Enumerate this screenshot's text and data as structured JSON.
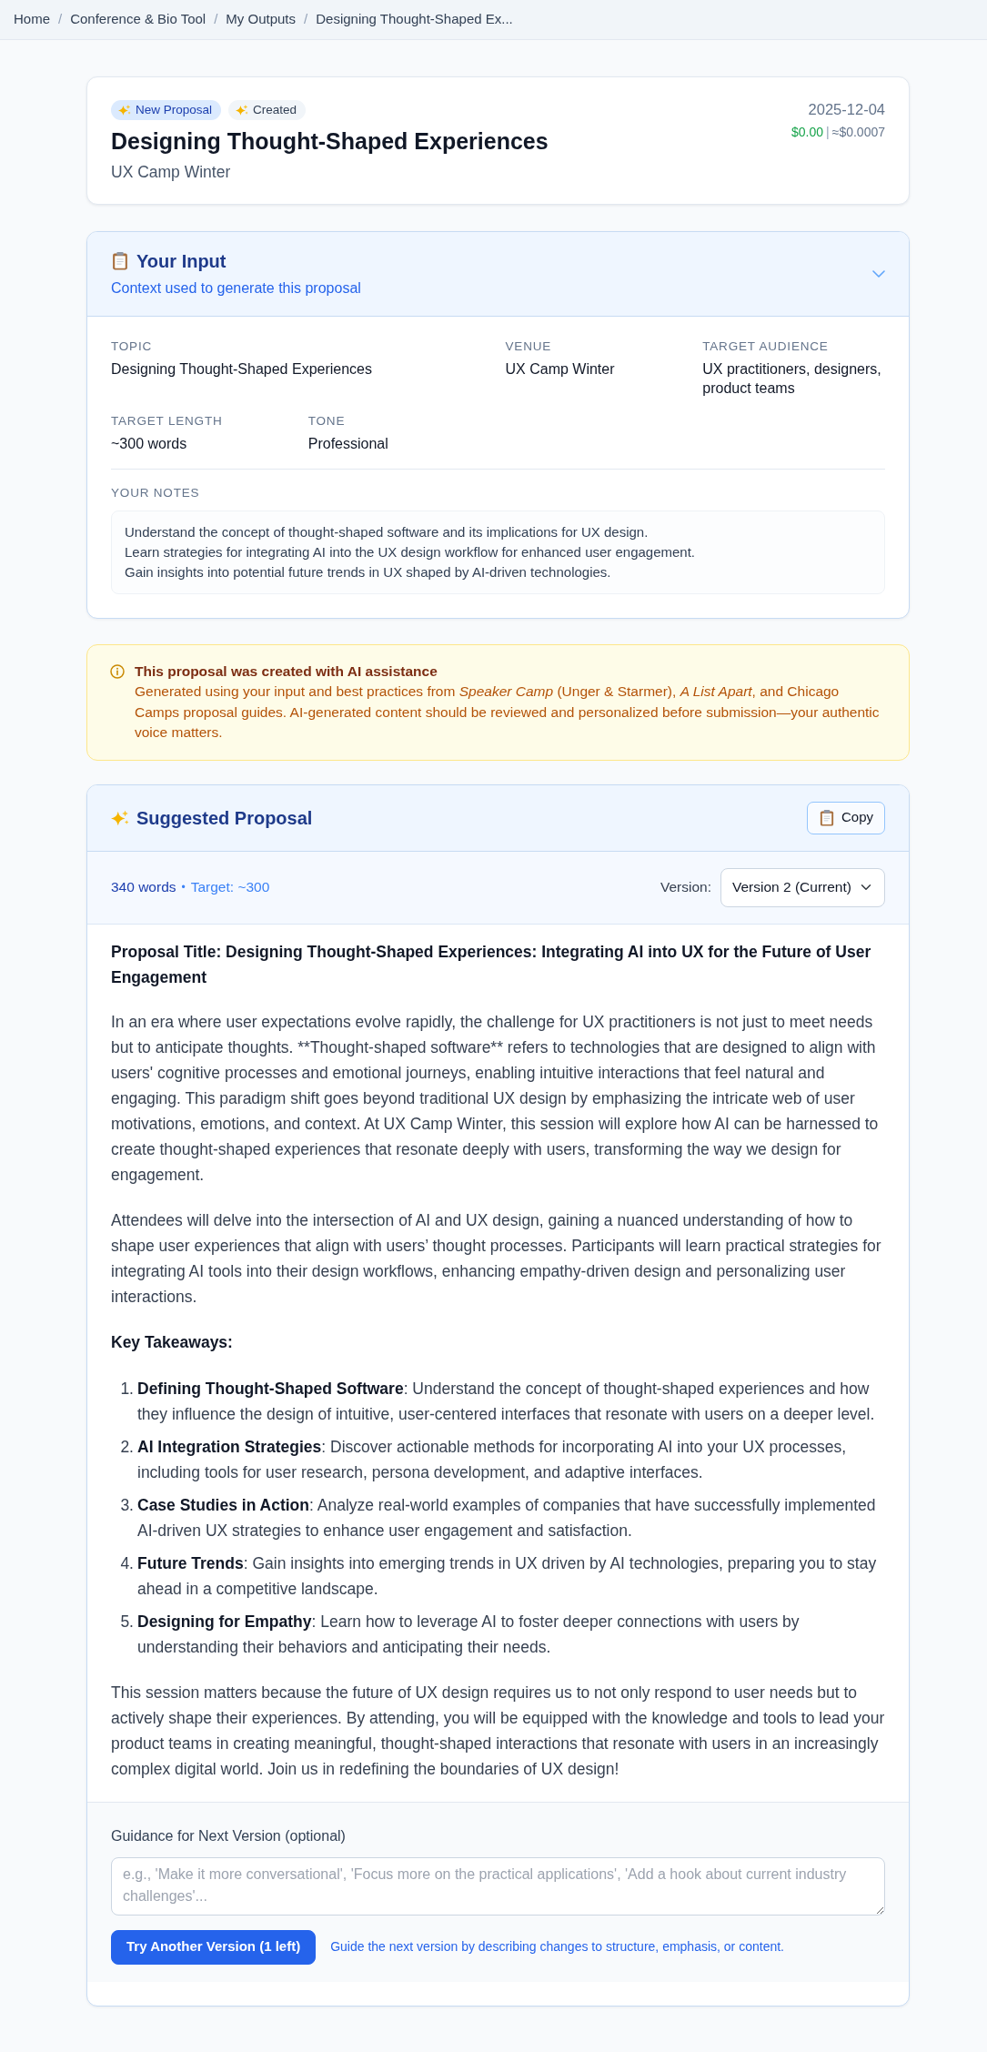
{
  "breadcrumb": [
    {
      "label": "Home",
      "separator": "/"
    },
    {
      "label": "Conference & Bio Tool",
      "separator": "/"
    },
    {
      "label": "My Outputs",
      "separator": "/"
    },
    {
      "label": "Designing Thought-Shaped Ex..."
    }
  ],
  "header": {
    "badges": [
      {
        "label": "New Proposal",
        "kind": "primary"
      },
      {
        "label": "Created",
        "kind": "neutral"
      }
    ],
    "title": "Designing Thought-Shaped Experiences",
    "subtitle": "UX Camp Winter",
    "date": "2025-12-04",
    "cost": "$0.00",
    "cost_separator": "|",
    "estimate": "≈$0.0007"
  },
  "input_panel": {
    "title": "Your Input",
    "subtitle": "Context used to generate this proposal",
    "expanded": true,
    "fields": [
      {
        "label": "TOPIC",
        "value": "Designing Thought-Shaped Experiences"
      },
      {
        "label": "VENUE",
        "value": "UX Camp Winter"
      },
      {
        "label": "TARGET AUDIENCE",
        "value": "UX practitioners, designers, product teams"
      },
      {
        "label": "TARGET LENGTH",
        "value": "~300 words"
      },
      {
        "label": "TONE",
        "value": "Professional"
      }
    ],
    "notes_label": "YOUR NOTES",
    "notes": "Understand the concept of thought-shaped software and its implications for UX design.\nLearn strategies for integrating AI into the UX design workflow for enhanced user engagement.\nGain insights into potential future trends in UX shaped by AI-driven technologies."
  },
  "ai_notice": {
    "title": "This proposal was created with AI assistance",
    "text": "Generated using your input and best practices from *Speaker Camp* (Unger & Starmer), *A List Apart*, and Chicago Camps proposal guides. AI-generated content should be reviewed and personalized before submission—your authentic voice matters."
  },
  "proposal": {
    "title": "Suggested Proposal",
    "copy_button": "Copy",
    "word_count": "340 words",
    "separator": "•",
    "target": "Target: ~300",
    "version_label": "Version:",
    "version": "Version 2 (Current)",
    "blocks": [
      {
        "kind": "title",
        "text": "Proposal Title: Designing Thought-Shaped Experiences: Integrating AI into UX for the Future of User Engagement"
      },
      {
        "kind": "paragraph",
        "text": "In an era where user expectations evolve rapidly, the challenge for UX practitioners is not just to meet needs but to anticipate thoughts. **Thought-shaped software** refers to technologies that are designed to align with users' cognitive processes and emotional journeys, enabling intuitive interactions that feel natural and engaging. This paradigm shift goes beyond traditional UX design by emphasizing the intricate web of user motivations, emotions, and context. At UX Camp Winter, this session will explore how AI can be harnessed to create thought-shaped experiences that resonate deeply with users, transforming the way we design for engagement."
      },
      {
        "kind": "paragraph",
        "text": "Attendees will delve into the intersection of AI and UX design, gaining a nuanced understanding of how to shape user experiences that align with users’ thought processes. Participants will learn practical strategies for integrating AI tools into their design workflows, enhancing empathy-driven design and personalizing user interactions."
      },
      {
        "kind": "heading",
        "text": "Key Takeaways:"
      },
      {
        "kind": "list",
        "items": [
          {
            "number": "1.",
            "text": "**Defining Thought-Shaped Software**: Understand the concept of thought-shaped experiences and how they influence the design of intuitive, user-centered interfaces that resonate with users on a deeper level."
          },
          {
            "number": "2.",
            "text": "**AI Integration Strategies**: Discover actionable methods for incorporating AI into your UX processes, including tools for user research, persona development, and adaptive interfaces."
          },
          {
            "number": "3.",
            "text": "**Case Studies in Action**: Analyze real-world examples of companies that have successfully implemented AI-driven UX strategies to enhance user engagement and satisfaction."
          },
          {
            "number": "4.",
            "text": "**Future Trends**: Gain insights into emerging trends in UX driven by AI technologies, preparing you to stay ahead in a competitive landscape."
          },
          {
            "number": "5.",
            "text": "**Designing for Empathy**: Learn how to leverage AI to foster deeper connections with users by understanding their behaviors and anticipating their needs."
          }
        ]
      },
      {
        "kind": "paragraph",
        "text": "This session matters because the future of UX design requires us to not only respond to user needs but to actively shape their experiences. By attending, you will be equipped with the knowledge and tools to lead your product teams in creating meaningful, thought-shaped interactions that resonate with users in an increasingly complex digital world. Join us in redefining the boundaries of UX design!"
      }
    ],
    "guidance": {
      "label": "Guidance for Next Version (optional)",
      "placeholder": "e.g., 'Make it more conversational', 'Focus more on the practical applications', 'Add a hook about current industry challenges'...",
      "button": "Try Another Version (1 left)",
      "hint": "Guide the next version by describing changes to structure, emphasis, or content."
    }
  }
}
